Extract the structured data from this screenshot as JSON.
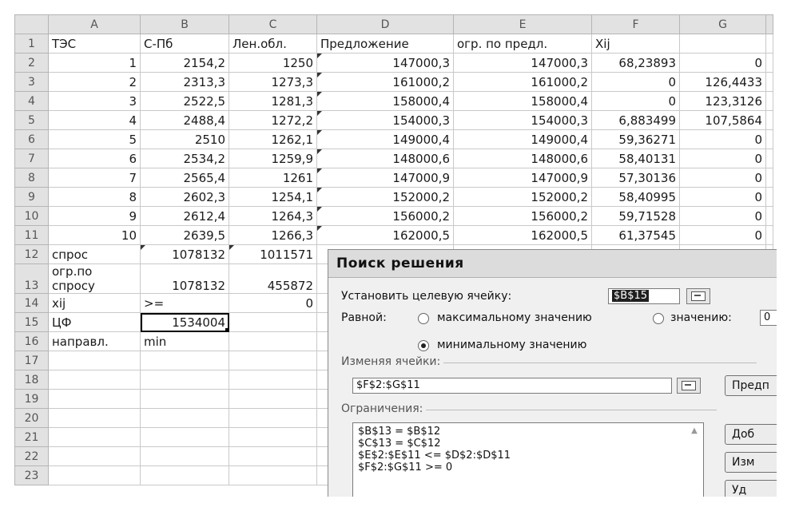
{
  "columns": [
    "A",
    "B",
    "C",
    "D",
    "E",
    "F",
    "G"
  ],
  "rows": [
    {
      "n": "1",
      "cells": [
        "ТЭС",
        "С-Пб",
        "Лен.обл.",
        "Предложение",
        "огр. по предл.",
        "Xij",
        ""
      ]
    },
    {
      "n": "2",
      "cells": [
        "1",
        "2154,2",
        "1250",
        "147000,3",
        "147000,3",
        "68,23893",
        "0"
      ]
    },
    {
      "n": "3",
      "cells": [
        "2",
        "2313,3",
        "1273,3",
        "161000,2",
        "161000,2",
        "0",
        "126,4433"
      ]
    },
    {
      "n": "4",
      "cells": [
        "3",
        "2522,5",
        "1281,3",
        "158000,4",
        "158000,4",
        "0",
        "123,3126"
      ]
    },
    {
      "n": "5",
      "cells": [
        "4",
        "2488,4",
        "1272,2",
        "154000,3",
        "154000,3",
        "6,883499",
        "107,5864"
      ]
    },
    {
      "n": "6",
      "cells": [
        "5",
        "2510",
        "1262,1",
        "149000,4",
        "149000,4",
        "59,36271",
        "0"
      ]
    },
    {
      "n": "7",
      "cells": [
        "6",
        "2534,2",
        "1259,9",
        "148000,6",
        "148000,6",
        "58,40131",
        "0"
      ]
    },
    {
      "n": "8",
      "cells": [
        "7",
        "2565,4",
        "1261",
        "147000,9",
        "147000,9",
        "57,30136",
        "0"
      ]
    },
    {
      "n": "9",
      "cells": [
        "8",
        "2602,3",
        "1254,1",
        "152000,2",
        "152000,2",
        "58,40995",
        "0"
      ]
    },
    {
      "n": "10",
      "cells": [
        "9",
        "2612,4",
        "1264,3",
        "156000,2",
        "156000,2",
        "59,71528",
        "0"
      ]
    },
    {
      "n": "11",
      "cells": [
        "10",
        "2639,5",
        "1266,3",
        "162000,5",
        "162000,5",
        "61,37545",
        "0"
      ]
    },
    {
      "n": "12",
      "cells": [
        "спрос",
        "1078132",
        "1011571",
        "",
        "",
        "",
        ""
      ]
    },
    {
      "n": "13",
      "cells": [
        "огр.по\nспросу",
        "1078132",
        "455872",
        "",
        "",
        "",
        ""
      ]
    },
    {
      "n": "14",
      "cells": [
        "xij",
        ">=",
        "0",
        "",
        "",
        "",
        ""
      ]
    },
    {
      "n": "15",
      "cells": [
        "ЦФ",
        "1534004",
        "",
        "",
        "",
        "",
        ""
      ]
    },
    {
      "n": "16",
      "cells": [
        "направл.",
        "min",
        "",
        "",
        "",
        "",
        ""
      ]
    },
    {
      "n": "17",
      "cells": [
        "",
        "",
        "",
        "",
        "",
        "",
        ""
      ]
    },
    {
      "n": "18",
      "cells": [
        "",
        "",
        "",
        "",
        "",
        "",
        ""
      ]
    },
    {
      "n": "19",
      "cells": [
        "",
        "",
        "",
        "",
        "",
        "",
        ""
      ]
    },
    {
      "n": "20",
      "cells": [
        "",
        "",
        "",
        "",
        "",
        "",
        ""
      ]
    },
    {
      "n": "21",
      "cells": [
        "",
        "",
        "",
        "",
        "",
        "",
        ""
      ]
    },
    {
      "n": "22",
      "cells": [
        "",
        "",
        "",
        "",
        "",
        "",
        ""
      ]
    },
    {
      "n": "23",
      "cells": [
        "",
        "",
        "",
        "",
        "",
        "",
        ""
      ]
    }
  ],
  "dialog": {
    "title": "Поиск решения",
    "target_label": "Установить целевую ячейку:",
    "target_value": "$B$15",
    "equal_label": "Равной:",
    "opt_max": "максимальному значению",
    "opt_value": "значению:",
    "opt_value_input": "0",
    "opt_min": "минимальному значению",
    "changing_label": "Изменяя ячейки:",
    "changing_value": "$F$2:$G$11",
    "guess_button": "Предп",
    "constraints_label": "Ограничения:",
    "constraints": [
      "$B$13 = $B$12",
      "$C$13 = $C$12",
      "$E$2:$E$11 <= $D$2:$D$11",
      "$F$2:$G$11 >= 0"
    ],
    "add_button": "Доб",
    "change_button": "Изм",
    "delete_button": "Уд"
  }
}
